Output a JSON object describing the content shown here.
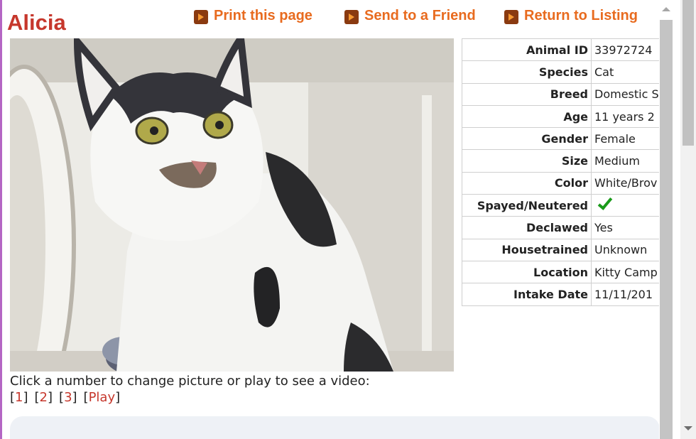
{
  "page": {
    "title": "Alicia"
  },
  "actions": [
    {
      "label": "Print this page",
      "icon": "arrow-right-icon"
    },
    {
      "label": "Send to a Friend",
      "icon": "arrow-right-icon"
    },
    {
      "label": "Return to Listing",
      "icon": "arrow-right-icon"
    }
  ],
  "details": [
    {
      "label": "Animal ID",
      "value": "33972724"
    },
    {
      "label": "Species",
      "value": "Cat"
    },
    {
      "label": "Breed",
      "value": "Domestic S"
    },
    {
      "label": "Age",
      "value": "11 years 2"
    },
    {
      "label": "Gender",
      "value": "Female"
    },
    {
      "label": "Size",
      "value": "Medium"
    },
    {
      "label": "Color",
      "value": "White/Brov"
    },
    {
      "label": "Spayed/Neutered",
      "value": "",
      "icon": "checkmark-icon"
    },
    {
      "label": "Declawed",
      "value": "Yes"
    },
    {
      "label": "Housetrained",
      "value": "Unknown"
    },
    {
      "label": "Location",
      "value": "Kitty Camp"
    },
    {
      "label": "Intake Date",
      "value": "11/11/201"
    }
  ],
  "media": {
    "caption": "Click a number to change picture or play to see a video:",
    "links": [
      "1",
      "2",
      "3",
      "Play"
    ]
  },
  "colors": {
    "title": "#c6372c",
    "action": "#e86b1f",
    "link": "#c6372c",
    "check": "#1a9a1a"
  }
}
